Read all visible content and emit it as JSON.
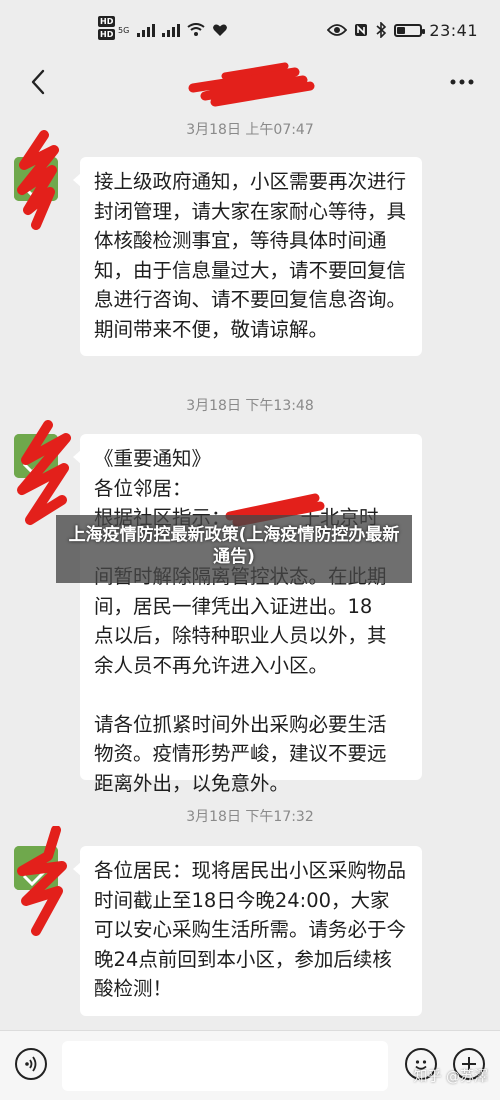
{
  "status_bar": {
    "hd1": "HD",
    "hd2": "HD",
    "network": "5G",
    "time": "23:41",
    "battery_level": 0.35
  },
  "header": {
    "title": ""
  },
  "messages": [
    {
      "timestamp": "3月18日 上午07:47",
      "text": "接上级政府通知，小区需要再次进行封闭管理，请大家在家耐心等待，具体核酸检测事宜，等待具体时间通知，由于信息量过大，请不要回复信息进行咨询、请不要回复信息咨询。期间带来不便，敬请谅解。"
    },
    {
      "timestamp": "3月18日 下午13:48",
      "line1": "《重要通知》",
      "line2": "各位邻居：",
      "line3_start": "根据社区指示：",
      "line3_end": "于北京时",
      "line4": "",
      "line5": "间暂时解除隔离管控状态。在此期",
      "line6": "间，居民一律凭出入证进出。18",
      "line7": "点以后，除特种职业人员以外，其",
      "line8": "余人员不再允许进入小区。",
      "line9": "请各位抓紧时间外出采购必要生活",
      "line10": "物资。疫情形势严峻，建议不要远",
      "line11": "距离外出，以免意外。"
    },
    {
      "timestamp": "3月18日 下午17:32",
      "text": "各位居民：现将居民出小区采购物品时间截止至18日今晚24:00，大家可以安心采购生活所需。请务必于今晚24点前回到本小区，参加后续核酸检测！"
    }
  ],
  "overlay": {
    "banner": "上海疫情防控最新政策(上海疫情防控办最新通告)"
  },
  "input_bar": {
    "placeholder": ""
  },
  "watermark": "知乎 @苏澤",
  "colors": {
    "background": "#ededed",
    "bubble": "#ffffff",
    "avatar_green": "#6fa84c",
    "scribble_red": "#e3201b"
  }
}
